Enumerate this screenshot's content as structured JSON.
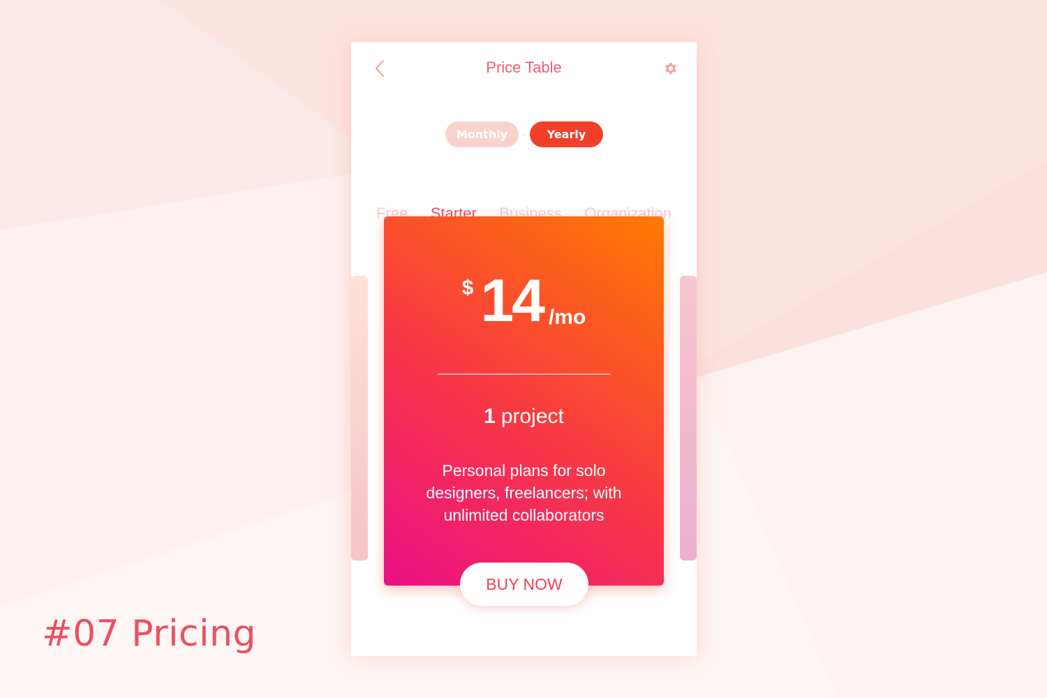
{
  "colors": {
    "accent": "#ef4e63",
    "toggle_active": "#f0402a",
    "card_gradient_start": "#ff7a00",
    "card_gradient_end": "#ec0f86"
  },
  "shot_label": "#07 Pricing",
  "header": {
    "title": "Price Table",
    "back_icon": "chevron-left-icon",
    "settings_icon": "gear-icon"
  },
  "billing_toggle": {
    "options": [
      "Monthly",
      "Yearly"
    ],
    "selected": "Yearly",
    "separator": "·"
  },
  "plan_tabs": {
    "items": [
      "Free",
      "Starter",
      "Business",
      "Organization"
    ],
    "selected": "Starter"
  },
  "plan_card": {
    "currency": "$",
    "amount": "14",
    "period": "/mo",
    "projects_count": "1",
    "projects_label": "project",
    "description_lines": [
      "Personal plans for solo",
      "designers, freelancers; with",
      "unlimited collaborators"
    ],
    "cta_label": "BUY NOW"
  }
}
